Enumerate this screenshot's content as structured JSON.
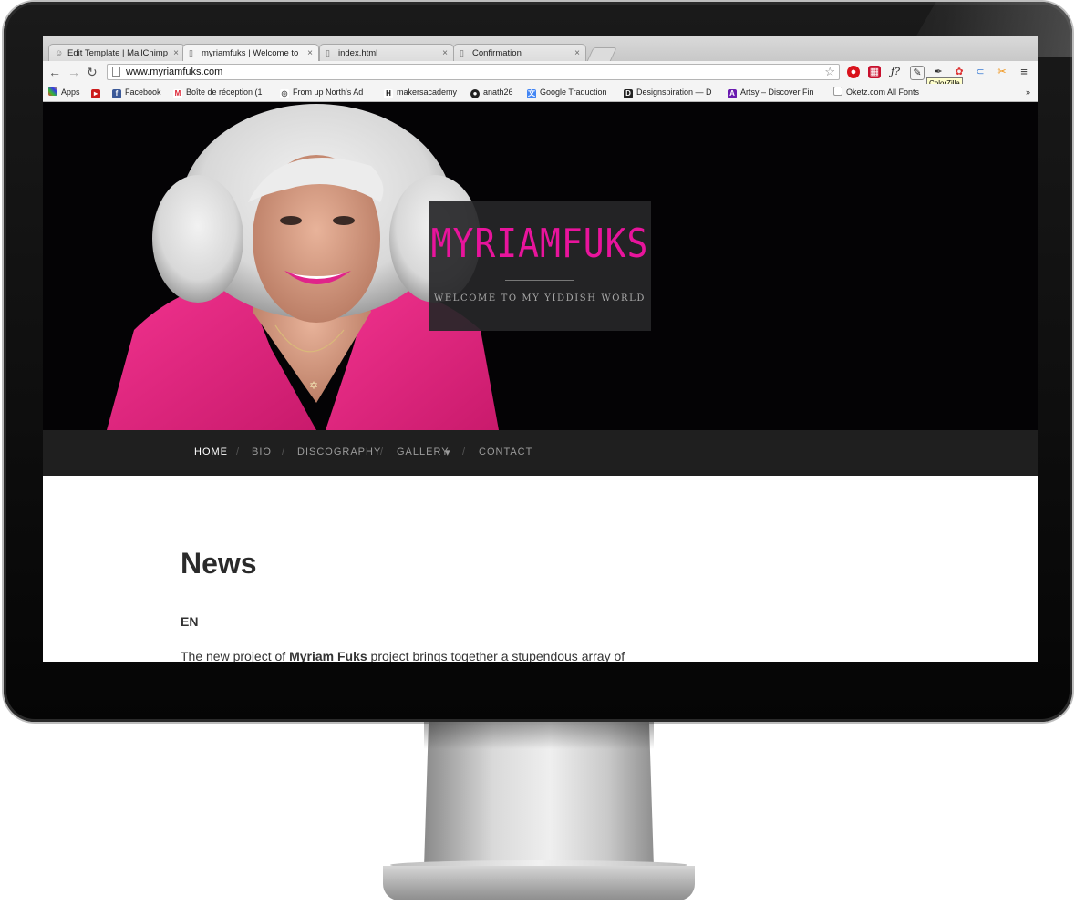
{
  "browser": {
    "tabs": [
      {
        "title": "Edit Template | MailChimp",
        "icon": "mailchimp-icon"
      },
      {
        "title": "myriamfuks | Welcome to",
        "icon": "page-icon"
      },
      {
        "title": "index.html",
        "icon": "page-icon"
      },
      {
        "title": "Confirmation",
        "icon": "page-icon"
      }
    ],
    "url": "www.myriamfuks.com",
    "tooltip": "ColorZilla",
    "bookmarks": [
      {
        "label": "Apps"
      },
      {
        "label": ""
      },
      {
        "label": "Facebook"
      },
      {
        "label": "Boîte de réception (1"
      },
      {
        "label": "From up North's Ad"
      },
      {
        "label": "makersacademy"
      },
      {
        "label": "anath26"
      },
      {
        "label": "Google Traduction"
      },
      {
        "label": "Designspiration — D"
      },
      {
        "label": "Artsy – Discover Fin"
      },
      {
        "label": "Oketz.com All Fonts"
      }
    ],
    "overflow": "»"
  },
  "site": {
    "title": "MYRIAMFUKS",
    "tagline": "WELCOME TO MY YIDDISH WORLD",
    "nav": [
      {
        "label": "HOME",
        "active": true
      },
      {
        "label": "BIO",
        "active": false
      },
      {
        "label": "DISCOGRAPHY",
        "active": false
      },
      {
        "label": "GALLERY",
        "active": false
      },
      {
        "label": "CONTACT",
        "active": false
      }
    ],
    "nav_separator": "/",
    "gallery_caret": "▾",
    "news_heading": "News",
    "language_label": "EN",
    "paragraph_start": "The new project of ",
    "paragraph_bold": "Myriam Fuks",
    "paragraph_end": " project brings together a stupendous array of"
  },
  "colors": {
    "accent": "#e8149c",
    "jacket": "#e0237f",
    "nav_bg": "#1f1f1f",
    "hero_bg": "#040305"
  }
}
